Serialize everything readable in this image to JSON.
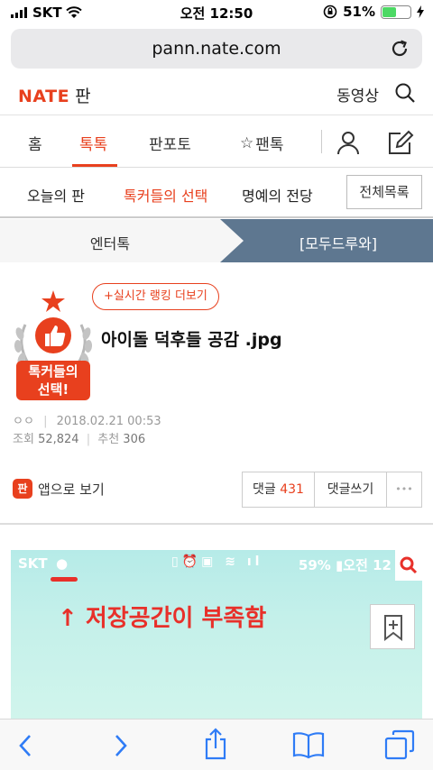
{
  "status_bar": {
    "carrier": "SKT",
    "time": "오전 12:50",
    "battery": "51%",
    "battery_level": 0.51
  },
  "browser": {
    "url": "pann.nate.com"
  },
  "header": {
    "logo": "NATE",
    "section": "판",
    "video_link": "동영상"
  },
  "main_tabs": [
    {
      "label": "홈",
      "active": false
    },
    {
      "label": "톡톡",
      "active": true
    },
    {
      "label": "판포토",
      "active": false
    },
    {
      "label": "팬톡",
      "active": false
    }
  ],
  "sub_menu": {
    "items": [
      {
        "label": "오늘의 판",
        "active": false
      },
      {
        "label": "톡커들의 선택",
        "active": true
      },
      {
        "label": "명예의 전당",
        "active": false
      }
    ],
    "full_list": "전체목록"
  },
  "segment": {
    "left": "엔터톡",
    "right": "[모두드루와]"
  },
  "article": {
    "ranking_button": "+실시간 랭킹 더보기",
    "badge_text_line1": "톡커들의",
    "badge_text_line2": "선택!",
    "title": "아이돌 덕후들 공감 .jpg",
    "author": "ㅇㅇ",
    "date": "2018.02.21 00:53",
    "views_label": "조회",
    "views": "52,824",
    "recommend_label": "추천",
    "recommend": "306"
  },
  "actions": {
    "app_icon": "판",
    "app_view": "앱으로 보기",
    "comments_label": "댓글",
    "comments_count": "431",
    "write_comment": "댓글쓰기",
    "more": "•••"
  },
  "embed": {
    "carrier": "SKT",
    "status_right": "59% ▮오전 12",
    "text": "↑ 저장공간이 부족함"
  },
  "colors": {
    "accent": "#e8401e",
    "segment_active": "#5e7790"
  }
}
